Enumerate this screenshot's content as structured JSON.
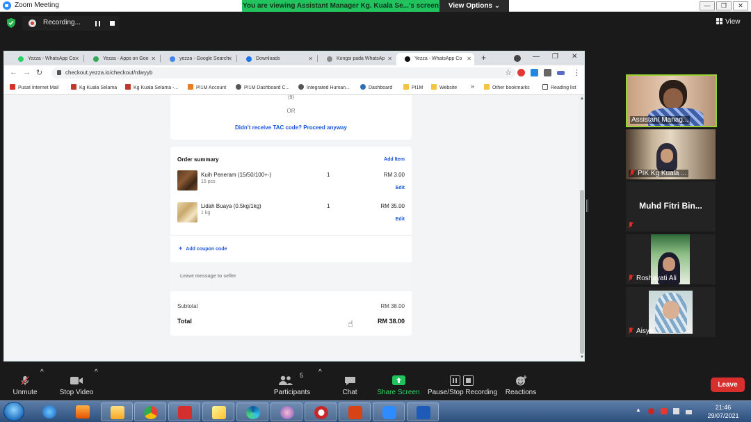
{
  "zoom": {
    "window_title": "Zoom Meeting",
    "viewing_banner": "You are viewing Assistant Manager Kg. Kuala Se...'s screen",
    "view_options": "View Options",
    "recording_label": "Recording...",
    "view_button": "View"
  },
  "browser": {
    "tabs": [
      {
        "label": "Yezza - WhatsApp Co",
        "color": "#25d366"
      },
      {
        "label": "Yezza - Apps on Goo",
        "color": "#34a853"
      },
      {
        "label": "yezza - Google Search",
        "color": "#4285f4"
      },
      {
        "label": "Downloads",
        "color": "#1a73e8"
      },
      {
        "label": "Kongsi pada WhatsAp",
        "color": "#888888"
      },
      {
        "label": "Yezza - WhatsApp Co",
        "color": "#111111"
      }
    ],
    "url": "checkout.yezza.io/checkout/rdwyyb",
    "bookmarks": [
      {
        "label": "Pusat Internet  Mail",
        "color": "#d93025"
      },
      {
        "label": "Kg Kuala Selama",
        "color": "#c0392b"
      },
      {
        "label": "Kg Kuala Selama -...",
        "color": "#c0392b"
      },
      {
        "label": "PI1M Account",
        "color": "#e67e22"
      },
      {
        "label": "PI1M Dashboard C...",
        "color": "#555555"
      },
      {
        "label": "Integrated Human...",
        "color": "#555555"
      },
      {
        "label": "Dashboard",
        "color": "#2c6fb7"
      },
      {
        "label": "PI1M",
        "color": "#f4c542"
      },
      {
        "label": "Website",
        "color": "#f4c542"
      }
    ],
    "more_bookmarks": "»",
    "other_bookmarks": "Other bookmarks",
    "reading_list": "Reading list"
  },
  "checkout": {
    "tac_number": "(9)",
    "or_text": "OR",
    "tac_link": "Didn't receive TAC code? Proceed anyway",
    "order_summary_title": "Order summary",
    "add_item": "Add Item",
    "items": [
      {
        "name": "Kuih Peneram (15/50/100+-)",
        "sub": "15 pcs",
        "qty": "1",
        "price": "RM 3.00",
        "edit": "Edit"
      },
      {
        "name": "Lidah Buaya (0.5kg/1kg)",
        "sub": "1 kg",
        "qty": "1",
        "price": "RM 35.00",
        "edit": "Edit"
      }
    ],
    "coupon": "Add coupon code",
    "message_placeholder": "Leave message to seller",
    "subtotal_label": "Subtotal",
    "subtotal_value": "RM 38.00",
    "total_label": "Total",
    "total_value": "RM 38.00"
  },
  "participants": [
    {
      "name": "Assistant Manag...",
      "muted": false,
      "active": true
    },
    {
      "name": "PIK Kg Kuala ...",
      "muted": true
    },
    {
      "name": "Muhd Fitri Bin...",
      "muted": true,
      "no_video": true
    },
    {
      "name": "Roshayati Ali",
      "muted": true
    },
    {
      "name": "Aisya",
      "muted": true
    }
  ],
  "toolbar": {
    "unmute": "Unmute",
    "stop_video": "Stop Video",
    "participants": "Participants",
    "participants_count": "5",
    "chat": "Chat",
    "share_screen": "Share Screen",
    "pause_stop_recording": "Pause/Stop Recording",
    "reactions": "Reactions",
    "leave": "Leave"
  },
  "taskbar": {
    "time": "21:46",
    "date": "29/07/2021"
  },
  "colors": {
    "accent_link": "#1a56db",
    "share_green": "#22c35e",
    "leave_red": "#d72e2e",
    "active_speaker": "#9bd336"
  }
}
